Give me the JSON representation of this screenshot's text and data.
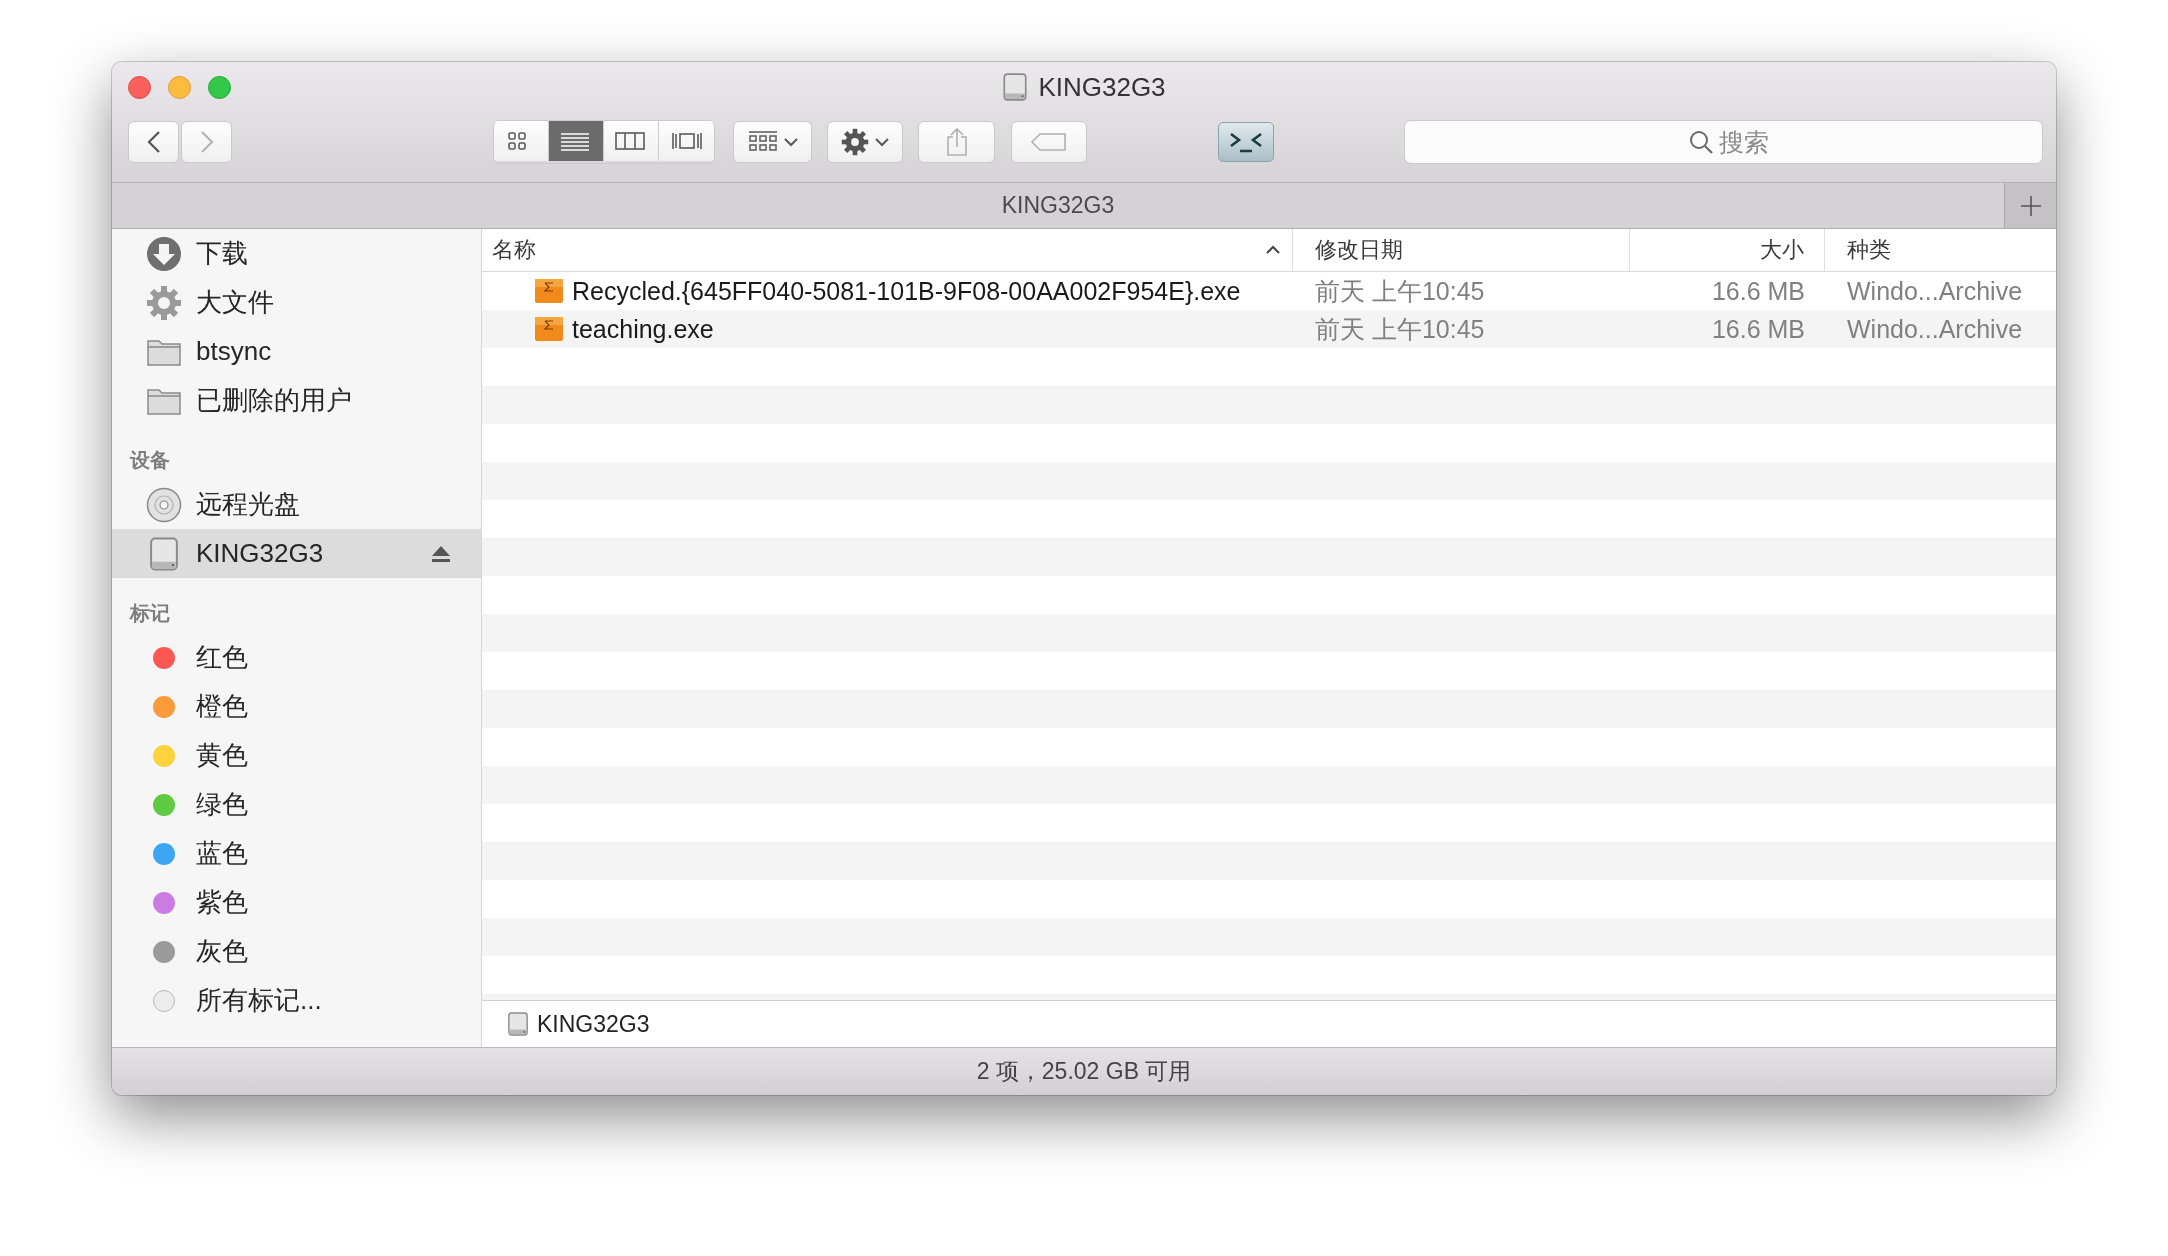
{
  "window": {
    "title": "KING32G3"
  },
  "toolbar": {
    "view_modes": [
      {
        "kind": "icons",
        "selected": false
      },
      {
        "kind": "list",
        "selected": true
      },
      {
        "kind": "columns",
        "selected": false
      },
      {
        "kind": "coverflow",
        "selected": false
      }
    ],
    "search": {
      "placeholder": "搜索"
    }
  },
  "tab_bar": {
    "title": "KING32G3"
  },
  "sidebar": {
    "sections": [
      {
        "items": [
          {
            "kind": "download",
            "label": "下载",
            "selected": false
          },
          {
            "kind": "gear",
            "label": "大文件",
            "selected": false
          },
          {
            "kind": "folder",
            "label": "btsync",
            "selected": false
          },
          {
            "kind": "folder",
            "label": "已删除的用户",
            "selected": false
          }
        ]
      },
      {
        "header": "设备",
        "items": [
          {
            "kind": "disc",
            "label": "远程光盘",
            "selected": false
          },
          {
            "kind": "drive",
            "label": "KING32G3",
            "selected": true
          }
        ]
      },
      {
        "header": "标记",
        "items": [
          {
            "kind": "tag",
            "label": "红色",
            "color": "#fc5753",
            "selected": false
          },
          {
            "kind": "tag",
            "label": "橙色",
            "color": "#fd9a3b",
            "selected": false
          },
          {
            "kind": "tag",
            "label": "黄色",
            "color": "#fdd23c",
            "selected": false
          },
          {
            "kind": "tag",
            "label": "绿色",
            "color": "#5ecb43",
            "selected": false
          },
          {
            "kind": "tag",
            "label": "蓝色",
            "color": "#3ca6f5",
            "selected": false
          },
          {
            "kind": "tag",
            "label": "紫色",
            "color": "#cb7ce0",
            "selected": false
          },
          {
            "kind": "tag",
            "label": "灰色",
            "color": "#9a9a9a",
            "selected": false
          },
          {
            "kind": "all_tags",
            "label": "所有标记...",
            "selected": false
          }
        ]
      }
    ]
  },
  "table": {
    "columns": [
      {
        "label": "名称",
        "sorted": true
      },
      {
        "label": "修改日期"
      },
      {
        "label": "大小"
      },
      {
        "label": "种类"
      }
    ],
    "rows": [
      {
        "name": "Recycled.{645FF040-5081-101B-9F08-00AA002F954E}.exe",
        "date": "前天 上午10:45",
        "size": "16.6 MB",
        "kind": "Windo...Archive"
      },
      {
        "name": "teaching.exe",
        "date": "前天 上午10:45",
        "size": "16.6 MB",
        "kind": "Windo...Archive"
      }
    ]
  },
  "path_bar": {
    "items": [
      "KING32G3"
    ]
  },
  "status_bar": "2 项，25.02 GB 可用"
}
